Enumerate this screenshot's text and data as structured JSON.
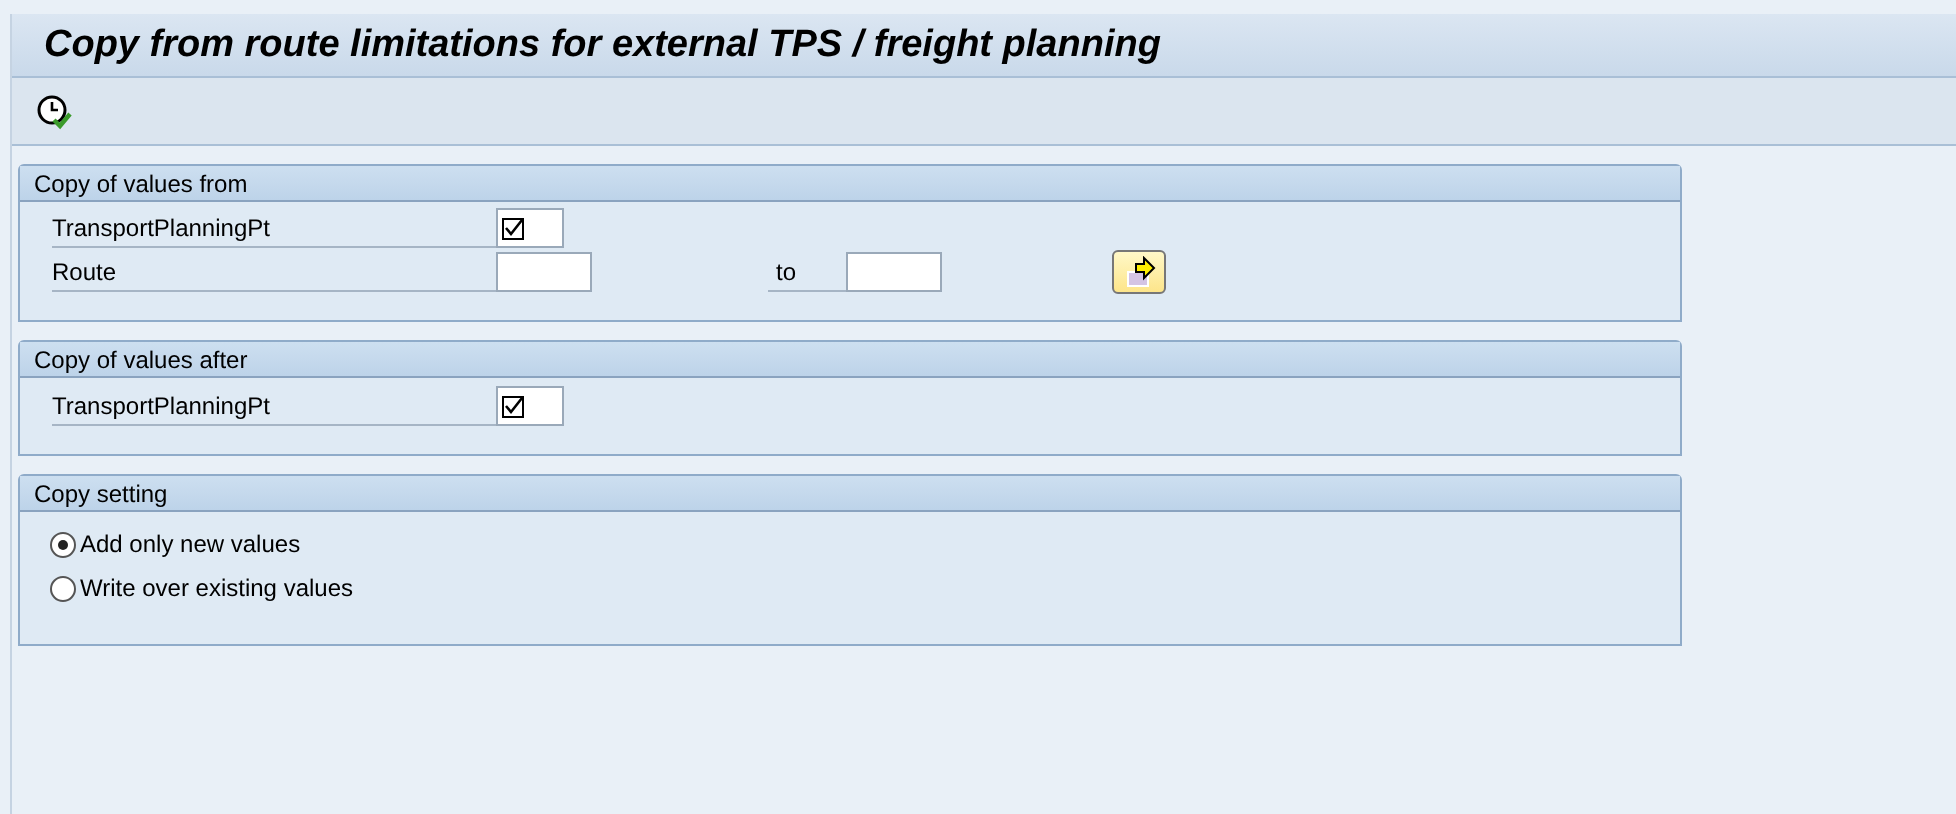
{
  "title": "Copy from route limitations for external TPS / freight planning",
  "groups": [
    {
      "title": "Copy of values from",
      "rows": [
        {
          "kind": "checkbox",
          "label": "TransportPlanningPt",
          "checked": true
        },
        {
          "kind": "range",
          "label": "Route",
          "to_label": "to"
        }
      ]
    },
    {
      "title": "Copy of values after",
      "rows": [
        {
          "kind": "checkbox",
          "label": "TransportPlanningPt",
          "checked": true
        }
      ]
    },
    {
      "title": "Copy setting",
      "rows": [
        {
          "kind": "radio",
          "label": "Add only new values",
          "selected": true
        },
        {
          "kind": "radio",
          "label": "Write over existing values",
          "selected": false
        }
      ]
    }
  ]
}
